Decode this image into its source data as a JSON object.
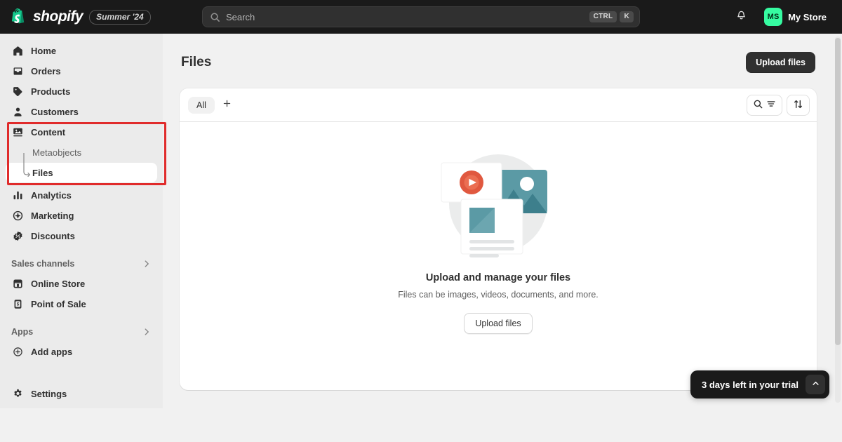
{
  "topbar": {
    "brand_name": "shopify",
    "season_badge": "Summer '24",
    "search_placeholder": "Search",
    "search_value": "",
    "kbd_ctrl": "CTRL",
    "kbd_key": "K",
    "avatar_initials": "MS",
    "store_name": "My Store",
    "bell_icon": "bell-icon",
    "search_icon": "search-icon"
  },
  "sidebar": {
    "items": [
      {
        "label": "Home",
        "icon": "home-icon"
      },
      {
        "label": "Orders",
        "icon": "orders-icon"
      },
      {
        "label": "Products",
        "icon": "products-tag-icon"
      },
      {
        "label": "Customers",
        "icon": "customers-person-icon"
      },
      {
        "label": "Content",
        "icon": "content-media-icon"
      }
    ],
    "content_children": [
      {
        "label": "Metaobjects",
        "active": false
      },
      {
        "label": "Files",
        "active": true
      }
    ],
    "items_after": [
      {
        "label": "Analytics",
        "icon": "analytics-bar-icon"
      },
      {
        "label": "Marketing",
        "icon": "marketing-megaphone-icon"
      },
      {
        "label": "Discounts",
        "icon": "discounts-percent-icon"
      }
    ],
    "sections": [
      {
        "title": "Sales channels",
        "items": [
          {
            "label": "Online Store",
            "icon": "online-store-icon"
          },
          {
            "label": "Point of Sale",
            "icon": "point-of-sale-icon"
          }
        ]
      },
      {
        "title": "Apps",
        "items": [
          {
            "label": "Add apps",
            "icon": "plus-circle-icon"
          }
        ]
      }
    ],
    "settings": {
      "label": "Settings",
      "icon": "gear-icon"
    },
    "annotation_color": "#e02b2b"
  },
  "main": {
    "page_title": "Files",
    "upload_button": "Upload files",
    "tabs": [
      {
        "label": "All",
        "active": true
      }
    ],
    "add_tab_icon": "plus-icon",
    "search_filter_icon": "search-filter-icon",
    "sort_icon": "sort-arrows-icon",
    "empty_state": {
      "illustration": "files-media-illustration",
      "title": "Upload and manage your files",
      "subtitle": "Files can be images, videos, documents, and more.",
      "button": "Upload files"
    }
  },
  "trial": {
    "text": "3 days left in your trial",
    "toggle_icon": "chevron-up-icon"
  },
  "colors": {
    "brand_green": "#36fba1",
    "topbar_bg": "#1a1a1a",
    "sidebar_bg": "#ebebeb",
    "page_bg": "#f1f1f1",
    "annotation_red": "#e02b2b",
    "illustration_teal": "#5b9aa5",
    "illustration_teal_dark": "#3d7f8c",
    "illustration_play_red": "#e0583f"
  }
}
